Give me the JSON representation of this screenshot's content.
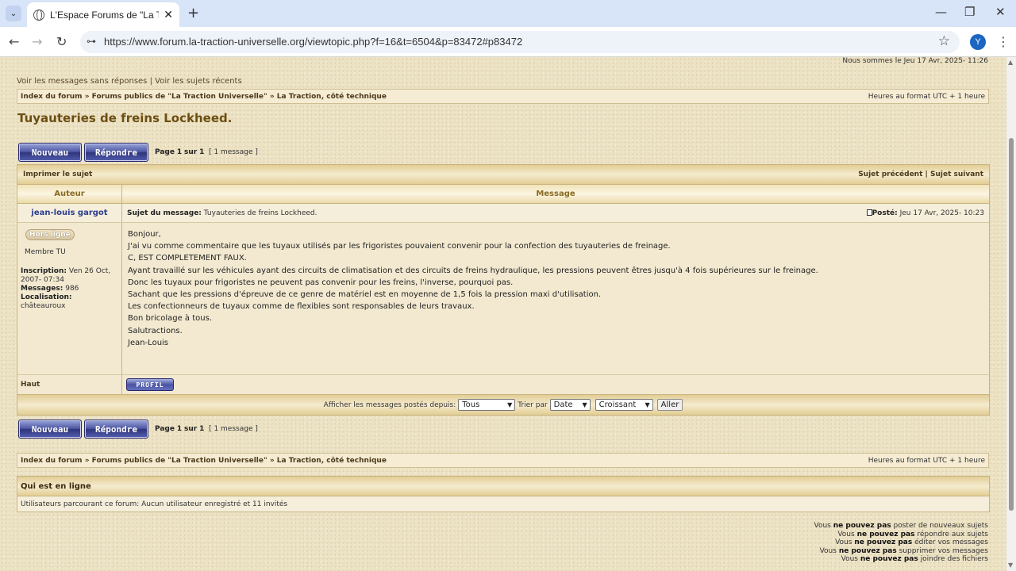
{
  "browser": {
    "tab_list_icon": "chevron-down-icon",
    "tab_title": "L'Espace Forums de \"La Traction",
    "tab_close": "✕",
    "new_tab": "+",
    "minimize": "—",
    "maximize": "❐",
    "close": "✕",
    "back": "←",
    "forward": "→",
    "reload": "↻",
    "site_settings": "⊶",
    "url": "https://www.forum.la-traction-universelle.org/viewtopic.php?f=16&t=6504&p=83472#p83472",
    "bookmark": "☆",
    "profile_initial": "Y",
    "menu": "⋮"
  },
  "header": {
    "current_date": "Nous sommes le Jeu 17 Avr, 2025- 11:26",
    "link_unanswered": "Voir les messages sans réponses",
    "separator": "|",
    "link_recent": "Voir les sujets récents"
  },
  "breadcrumb": {
    "index": "Index du forum",
    "sep": "»",
    "forum_public": "Forums publics de \"La Traction Universelle\"",
    "subforum": "La Traction, côté technique",
    "timezone": "Heures au format UTC + 1 heure"
  },
  "topic": {
    "title": "Tuyauteries de freins Lockheed.",
    "btn_new": "Nouveau",
    "btn_reply": "Répondre",
    "page_label": "Page",
    "page_current": "1",
    "page_sep": "sur",
    "page_total": "1",
    "message_count": "[ 1 message ]"
  },
  "table": {
    "print_topic": "Imprimer le sujet",
    "prev_topic": "Sujet précédent",
    "next_topic": "Sujet suivant",
    "col_author": "Auteur",
    "col_message": "Message"
  },
  "post": {
    "author": "jean-louis gargot",
    "subject_label": "Sujet du message:",
    "subject": "Tuyauteries de freins Lockheed.",
    "posted_icon": "post-icon",
    "posted_label": "Posté:",
    "posted_date": "Jeu 17 Avr, 2025- 10:23",
    "status": "Hors ligne",
    "rank": "Membre TU",
    "joined_label": "Inscription:",
    "joined": "Ven 26 Oct, 2007- 07:34",
    "posts_label": "Messages:",
    "posts": "986",
    "location_label": "Localisation:",
    "location": "châteauroux",
    "lines": [
      "Bonjour,",
      "J'ai vu comme commentaire que les tuyaux utilisés par les frigoristes pouvaient convenir pour la confection des tuyauteries de freinage.",
      "C, EST COMPLETEMENT FAUX.",
      "Ayant travaillé sur les véhicules ayant des circuits de climatisation et des circuits de freins hydraulique, les pressions peuvent êtres jusqu'à 4 fois supérieures sur le freinage.",
      "Donc les tuyaux pour frigoristes ne peuvent pas convenir pour les freins, l'inverse, pourquoi pas.",
      "Sachant que les pressions d'épreuve de ce genre de matériel est en moyenne de 1,5 fois la pression maxi d'utilisation.",
      "Les confectionneurs de tuyaux comme de flexibles sont responsables de leurs travaux.",
      "Bon bricolage à tous.",
      "Salutractions.",
      "Jean-Louis"
    ],
    "top_link": "Haut",
    "profile_btn": "PROFIL"
  },
  "sort": {
    "display_label": "Afficher les messages postés depuis:",
    "display_value": "Tous",
    "sort_label": "Trier par",
    "sort_value": "Date",
    "order_value": "Croissant",
    "go": "Aller"
  },
  "online": {
    "title": "Qui est en ligne",
    "text": "Utilisateurs parcourant ce forum: Aucun utilisateur enregistré et 11 invités"
  },
  "permissions": [
    {
      "pre": "Vous",
      "bold": "ne pouvez pas",
      "post": "poster de nouveaux sujets"
    },
    {
      "pre": "Vous",
      "bold": "ne pouvez pas",
      "post": "répondre aux sujets"
    },
    {
      "pre": "Vous",
      "bold": "ne pouvez pas",
      "post": "éditer vos messages"
    },
    {
      "pre": "Vous",
      "bold": "ne pouvez pas",
      "post": "supprimer vos messages"
    },
    {
      "pre": "Vous",
      "bold": "ne pouvez pas",
      "post": "joindre des fichiers"
    }
  ]
}
